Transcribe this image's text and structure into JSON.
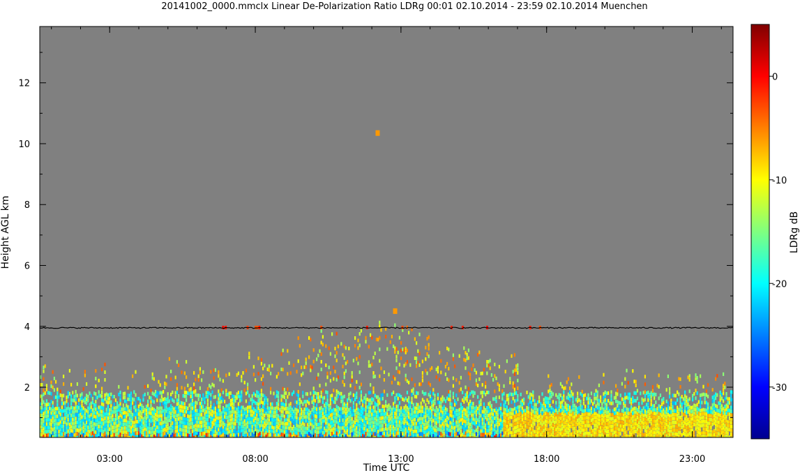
{
  "chart_data": {
    "type": "heatmap",
    "title": "20141002_0000.mmclx Linear De-Polarization Ratio LDRg   00:01 02.10.2014 - 23:59 02.10.2014 Muenchen",
    "xlabel": "Time UTC",
    "ylabel": "Height AGL km",
    "colorbar_label": "LDRg dB",
    "x_unit": "hour UTC",
    "xlim": [
      0.6,
      24.4
    ],
    "ylim": [
      0.35,
      13.85
    ],
    "x_ticks": [
      {
        "value": 3,
        "label": "03:00"
      },
      {
        "value": 8,
        "label": "08:00"
      },
      {
        "value": 13,
        "label": "13:00"
      },
      {
        "value": 18,
        "label": "18:00"
      },
      {
        "value": 23,
        "label": "23:00"
      }
    ],
    "y_ticks": [
      {
        "value": 2,
        "label": "2"
      },
      {
        "value": 4,
        "label": "4"
      },
      {
        "value": 6,
        "label": "6"
      },
      {
        "value": 8,
        "label": "8"
      },
      {
        "value": 10,
        "label": "10"
      },
      {
        "value": 12,
        "label": "12"
      }
    ],
    "colorbar": {
      "range": [
        -35,
        5
      ],
      "ticks": [
        {
          "value": 0,
          "label": "0"
        },
        {
          "value": -10,
          "label": "-10"
        },
        {
          "value": -20,
          "label": "-20"
        },
        {
          "value": -30,
          "label": "-30"
        }
      ],
      "colormap": "jet"
    },
    "background_color": "#808080",
    "cloud_top_line_height_km": 3.95,
    "cloud_top_line_color": "#000000",
    "observations": {
      "description_bands": [
        {
          "x_range": [
            0.6,
            24.4
          ],
          "height_range": [
            0.4,
            1.4
          ],
          "typical_ldr_db": -17
        },
        {
          "x_range": [
            16.5,
            24.4
          ],
          "height_range": [
            0.4,
            1.2
          ],
          "typical_ldr_db": -9
        }
      ],
      "isolated_returns": [
        {
          "x": 12.2,
          "height": 10.35,
          "ldr_db": -6
        },
        {
          "x": 12.8,
          "height": 4.5,
          "ldr_db": -6
        }
      ]
    }
  }
}
